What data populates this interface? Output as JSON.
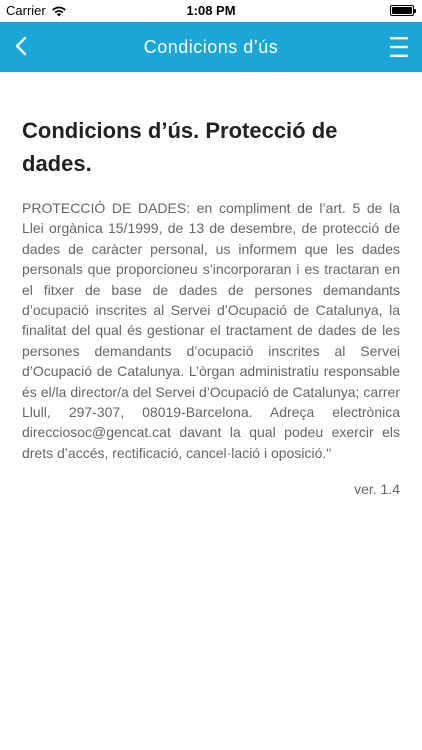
{
  "status_bar": {
    "carrier": "Carrier",
    "time": "1:08 PM"
  },
  "nav": {
    "title": "Condicions d’ús",
    "back_icon": "chevron-left-icon",
    "menu_icon": "hamburger-menu-icon",
    "color": "#1aa6d6"
  },
  "page": {
    "heading": "Condicions d’ús. Protecció de dades.",
    "body": "PROTECCIÓ DE DADES: en compliment de l’art. 5 de la Llei orgànica 15/1999, de 13 de desembre, de protecció de dades de caràcter personal, us informem que les dades personals que proporcioneu s’incorporaran i es tractaran en el fitxer de base de dades de persones demandants d’ocupació inscrites al Servei d’Ocupació de Catalunya, la finalitat del qual és gestionar el tractament de dades de les persones demandants d’ocupació inscrites al Servei d’Ocupació de Catalunya. L’òrgan administratiu responsable és el/la director/a del Servei d’Ocupació de Catalunya; carrer Llull, 297-307, 08019-Barcelona. Adreça electrònica direcciosoc@gencat.cat davant la qual podeu exercir els drets d’accés, rectificació, cancel·lació i oposició.\"",
    "version": "ver. 1.4"
  }
}
